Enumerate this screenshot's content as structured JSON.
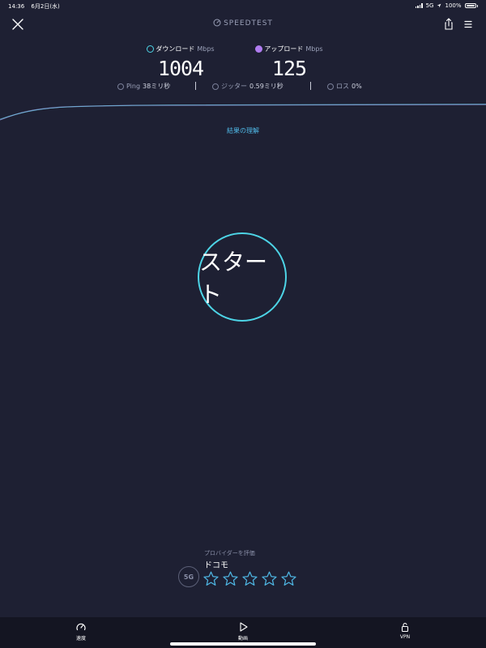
{
  "status_bar": {
    "time": "14:36",
    "date": "6月2日(水)",
    "network": "5G",
    "battery": "100%"
  },
  "header": {
    "brand": "SPEEDTEST"
  },
  "results": {
    "download": {
      "label": "ダウンロード",
      "unit": "Mbps",
      "value": "1004"
    },
    "upload": {
      "label": "アップロード",
      "unit": "Mbps",
      "value": "125"
    }
  },
  "metrics": {
    "ping": {
      "label": "Ping",
      "value": "38ミリ秒"
    },
    "jitter": {
      "label": "ジッター",
      "value": "0.59ミリ秒"
    },
    "loss": {
      "label": "ロス",
      "value": "0%"
    }
  },
  "understand_link": "結果の理解",
  "start_label": "スタート",
  "provider": {
    "prompt": "プロバイダーを評価",
    "name": "ドコモ",
    "badge": "5G",
    "rating": 0,
    "max_rating": 5
  },
  "tabs": [
    {
      "label": "速度"
    },
    {
      "label": "動画"
    },
    {
      "label": "VPN"
    }
  ],
  "colors": {
    "background": "#1e2033",
    "accent_cyan": "#4dd4e6",
    "upload_purple": "#b07cf0",
    "link_blue": "#4fb8e6",
    "tabbar": "#141522"
  }
}
